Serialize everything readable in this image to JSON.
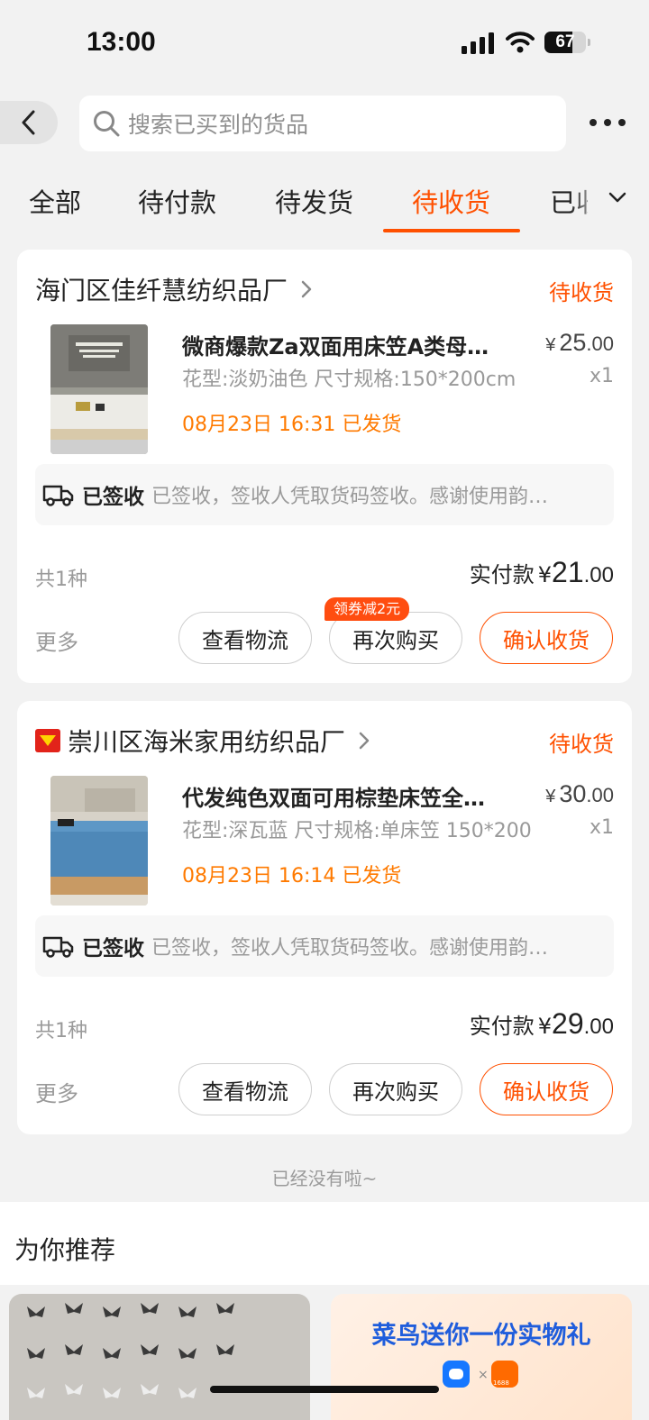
{
  "status_bar": {
    "time": "13:00",
    "battery": "67",
    "battery_level": 0.67
  },
  "search": {
    "placeholder": "搜索已买到的货品"
  },
  "tabs": [
    {
      "label": "全部"
    },
    {
      "label": "待付款"
    },
    {
      "label": "待发货"
    },
    {
      "label": "待收货",
      "active": true
    },
    {
      "label": "已收"
    }
  ],
  "orders": [
    {
      "shop": "海门区佳纤慧纺织品厂",
      "status": "待收货",
      "product_title": "微商爆款Za双面用床笠A类母…",
      "price_currency": "¥",
      "price_int": "25",
      "price_dec": ".00",
      "spec": "花型:淡奶油色 尺寸规格:150*200cm",
      "qty": "x1",
      "ship_info": "08月23日 16:31 已发货",
      "logistics_state": "已签收",
      "logistics_detail": "已签收，签收人凭取货码签收。感谢使用韵…",
      "kinds": "共1种",
      "paid_label": "实付款",
      "paid_currency": "¥",
      "paid_int": "21",
      "paid_dec": ".00",
      "more": "更多",
      "btn_logistics": "查看物流",
      "btn_rebuy": "再次购买",
      "btn_confirm": "确认收货",
      "coupon": "领券减2元"
    },
    {
      "shop": "崇川区海米家用纺织品厂",
      "status": "待收货",
      "product_title": "代发纯色双面可用棕垫床笠全…",
      "price_currency": "¥",
      "price_int": "30",
      "price_dec": ".00",
      "spec": "花型:深瓦蓝 尺寸规格:单床笠 150*200",
      "qty": "x1",
      "ship_info": "08月23日 16:14 已发货",
      "logistics_state": "已签收",
      "logistics_detail": "已签收，签收人凭取货码签收。感谢使用韵…",
      "kinds": "共1种",
      "paid_label": "实付款",
      "paid_currency": "¥",
      "paid_int": "29",
      "paid_dec": ".00",
      "more": "更多",
      "btn_logistics": "查看物流",
      "btn_rebuy": "再次购买",
      "btn_confirm": "确认收货"
    }
  ],
  "end_note": "已经没有啦~",
  "recommend": {
    "title": "为你推荐",
    "promo_text": "菜鸟送你一份实物礼",
    "promo_badge": "1688"
  },
  "colors": {
    "accent": "#ff5000",
    "ship": "#ff7a00",
    "bg": "#f2f2f2"
  }
}
